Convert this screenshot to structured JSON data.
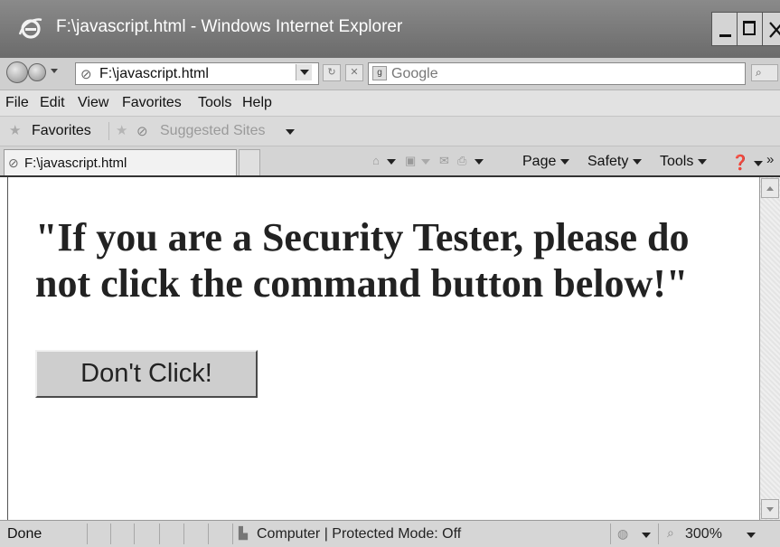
{
  "window": {
    "title": "F:\\javascript.html - Windows Internet Explorer"
  },
  "address_bar": {
    "url": "F:\\javascript.html",
    "search_placeholder": "Google"
  },
  "menu": {
    "items": [
      "File",
      "Edit",
      "View",
      "Favorites",
      "Tools",
      "Help"
    ]
  },
  "favorites_bar": {
    "favorites_label": "Favorites",
    "suggested_sites_label": "Suggested Sites"
  },
  "tab": {
    "label": "F:\\javascript.html"
  },
  "command_bar": {
    "page_label": "Page",
    "safety_label": "Safety",
    "tools_label": "Tools"
  },
  "content": {
    "heading": "\"If you are a Security Tester, please do not click the command button below!\"",
    "button_label": "Don't Click!"
  },
  "status_bar": {
    "status_text": "Done",
    "zone_text": "Computer | Protected Mode: Off",
    "zoom_level": "300%"
  },
  "icons": {
    "browser_logo": "internet-explorer-logo",
    "back": "back-arrow-icon",
    "forward": "forward-arrow-icon",
    "page": "page-icon",
    "refresh": "refresh-icon",
    "stop": "stop-icon",
    "search": "search-icon",
    "favorites": "star-icon",
    "add_favorite": "add-favorite-icon",
    "home": "home-icon",
    "feeds": "rss-feed-icon",
    "mail": "mail-icon",
    "print": "print-icon",
    "help": "help-icon",
    "computer": "computer-icon",
    "globe": "globe-icon",
    "zoom": "zoom-icon"
  },
  "colors": {
    "title_bar": "#7a7a7a",
    "content_background": "#ffffff",
    "button_face": "#cecece"
  }
}
